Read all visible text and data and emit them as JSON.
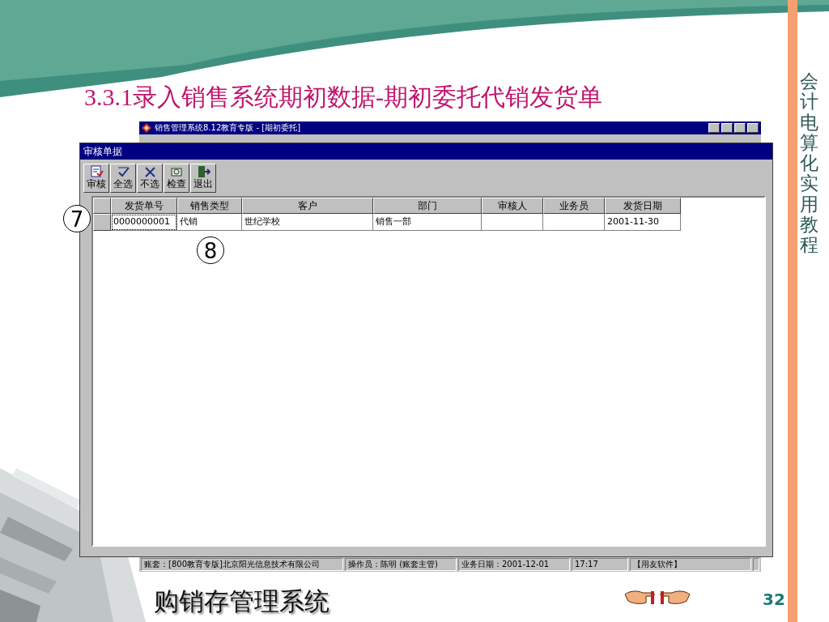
{
  "slide": {
    "title": "3.3.1录入销售系统期初数据-期初委托代销发货单",
    "side_title": "会计电算化实用教程",
    "footer": "购销存管理系统",
    "page_number": "32"
  },
  "app_window": {
    "title": "销售管理系统8.12教育专版 - [期初委托]"
  },
  "dialog": {
    "title": "审核单据",
    "toolbar": [
      {
        "label": "审核",
        "kind": "audit"
      },
      {
        "label": "全选",
        "kind": "select-all"
      },
      {
        "label": "不选",
        "kind": "select-none"
      },
      {
        "label": "检查",
        "kind": "check"
      },
      {
        "label": "退出",
        "kind": "exit"
      }
    ],
    "table": {
      "columns": [
        "发货单号",
        "销售类型",
        "客户",
        "部门",
        "审核人",
        "业务员",
        "发货日期"
      ],
      "rows": [
        {
          "selected": true,
          "cells": [
            "0000000001",
            "代销",
            "世纪学校",
            "销售一部",
            null,
            null,
            "2001-11-30"
          ]
        }
      ]
    }
  },
  "callouts": [
    {
      "label": "7"
    },
    {
      "label": "8"
    }
  ],
  "status_bar": [
    "账套：[800教育专版]北京阳光信息技术有限公司",
    "操作员：陈明 (账套主管)",
    "业务日期：2001-12-01",
    "17:17",
    "【用友软件】"
  ]
}
